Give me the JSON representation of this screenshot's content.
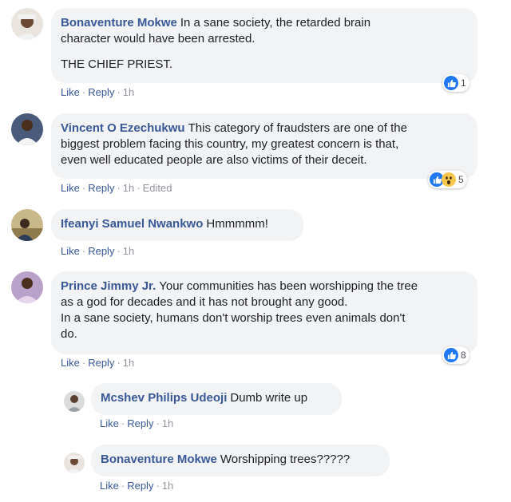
{
  "comments": [
    {
      "author": "Bonaventure Mokwe",
      "paragraphs": [
        [
          "In a sane society, the retarded brain",
          "character would have been arrested."
        ],
        [
          "THE CHIEF PRIEST."
        ]
      ],
      "actions": {
        "like": "Like",
        "reply": "Reply",
        "time": "1h"
      },
      "reactions": {
        "icons": [
          "like-icon"
        ],
        "count": "1"
      }
    },
    {
      "author": "Vincent O Ezechukwu",
      "paragraphs": [
        [
          "This category of fraudsters are one of the",
          "biggest problem facing this country, my greatest concern is that,",
          "even well educated people are also victims of their deceit."
        ]
      ],
      "actions": {
        "like": "Like",
        "reply": "Reply",
        "time": "1h",
        "edited": "Edited"
      },
      "reactions": {
        "icons": [
          "like-icon",
          "wow-icon"
        ],
        "count": "5"
      }
    },
    {
      "author": "Ifeanyi Samuel Nwankwo",
      "paragraphs": [
        [
          "Hmmmmm!"
        ]
      ],
      "actions": {
        "like": "Like",
        "reply": "Reply",
        "time": "1h"
      }
    },
    {
      "author": "Prince Jimmy Jr.",
      "paragraphs": [
        [
          "Your communities has been worshipping the tree",
          "as a god for decades and it has not brought any good.",
          "In a sane society, humans don't worship trees even animals don't",
          "do."
        ]
      ],
      "actions": {
        "like": "Like",
        "reply": "Reply",
        "time": "1h"
      },
      "reactions": {
        "icons": [
          "like-icon"
        ],
        "count": "8"
      }
    }
  ],
  "replies": [
    {
      "author": "Mcshev Philips Udeoji",
      "text": "Dumb write up",
      "actions": {
        "like": "Like",
        "reply": "Reply",
        "time": "1h"
      }
    },
    {
      "author": "Bonaventure Mokwe",
      "text": "Worshipping trees?????",
      "actions": {
        "like": "Like",
        "reply": "Reply",
        "time": "1h"
      }
    }
  ],
  "separator": "·",
  "colors": {
    "link": "#385898",
    "bubble": "#f2f3f5",
    "meta": "#90949c",
    "like_blue": "#2078f4",
    "wow_yellow": "#f7c74b"
  }
}
